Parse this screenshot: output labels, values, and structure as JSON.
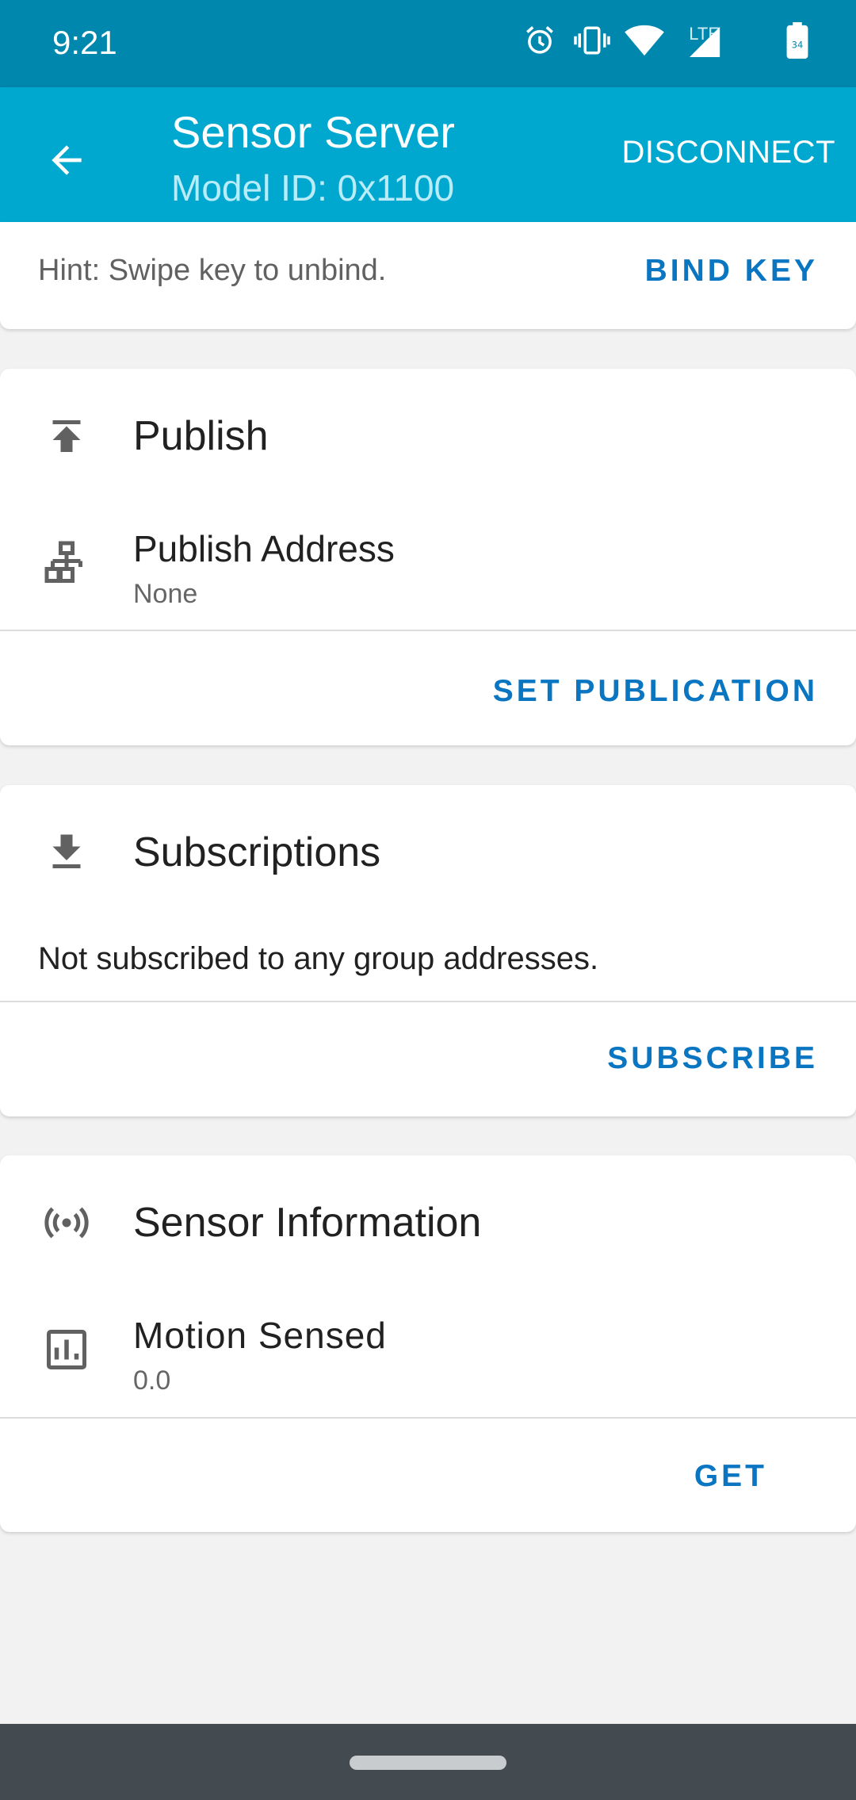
{
  "status_bar": {
    "time": "9:21",
    "icons": [
      "alarm-icon",
      "vibrate-icon",
      "wifi-icon",
      "lte-signal-icon",
      "battery-icon"
    ],
    "lte_label": "LTE",
    "battery_level": "34"
  },
  "app_bar": {
    "title": "Sensor Server",
    "subtitle": "Model ID: 0x1100",
    "disconnect_label": "DISCONNECT",
    "background_color": "#00a8d0"
  },
  "bind_card": {
    "hint": "Hint: Swipe key to unbind.",
    "bind_key_label": "BIND KEY"
  },
  "publish_card": {
    "title": "Publish",
    "address_title": "Publish Address",
    "address_value": "None",
    "set_publication_label": "SET PUBLICATION"
  },
  "subscriptions_card": {
    "title": "Subscriptions",
    "empty_text": "Not subscribed to any group addresses.",
    "subscribe_label": "SUBSCRIBE"
  },
  "sensor_card": {
    "title": "Sensor Information",
    "sensor_name": "Motion Sensed",
    "sensor_value": "0.0",
    "get_label": "GET"
  },
  "colors": {
    "status_bar": "#0087ad",
    "accent_text_button": "#0a76c2"
  }
}
